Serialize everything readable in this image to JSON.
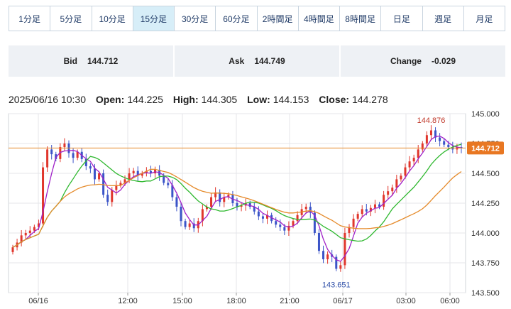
{
  "timeframes": [
    {
      "label": "1分足"
    },
    {
      "label": "5分足"
    },
    {
      "label": "10分足"
    },
    {
      "label": "15分足"
    },
    {
      "label": "30分足"
    },
    {
      "label": "60分足"
    },
    {
      "label": "2時間足"
    },
    {
      "label": "4時間足"
    },
    {
      "label": "8時間足"
    },
    {
      "label": "日足"
    },
    {
      "label": "週足"
    },
    {
      "label": "月足"
    }
  ],
  "quote": {
    "bid_label": "Bid",
    "bid_value": "144.712",
    "ask_label": "Ask",
    "ask_value": "144.749",
    "change_label": "Change",
    "change_value": "-0.029"
  },
  "ohlc": {
    "datetime": "2025/06/16 10:30",
    "open_label": "Open:",
    "open_value": "144.225",
    "high_label": "High:",
    "high_value": "144.305",
    "low_label": "Low:",
    "low_value": "144.153",
    "close_label": "Close:",
    "close_value": "144.278"
  },
  "colors": {
    "up": "#e0362c",
    "down": "#3b54c8",
    "ma_short": "#a020c8",
    "ma_mid": "#2fb82f",
    "ma_long": "#e58a2a",
    "bid_line": "#e58a2a",
    "bid_label_bg": "#e87722",
    "grid": "#e4e6ea"
  },
  "chart_data": {
    "type": "candlestick",
    "ylim": [
      143.5,
      145.0
    ],
    "y_ticks": [
      "145.000",
      "144.750",
      "144.500",
      "144.250",
      "144.000",
      "143.750",
      "143.500"
    ],
    "x_ticks": [
      "06/16",
      "12:00",
      "15:00",
      "18:00",
      "21:00",
      "06/17",
      "03:00",
      "06:00"
    ],
    "current_bid": 144.712,
    "current_bid_label": "144.712",
    "high_annotation": "144.876",
    "low_annotation": "143.651",
    "closes": [
      143.88,
      143.92,
      143.98,
      144.0,
      144.02,
      144.05,
      144.08,
      144.55,
      144.7,
      144.66,
      144.62,
      144.72,
      144.75,
      144.67,
      144.63,
      144.68,
      144.62,
      144.56,
      144.54,
      144.45,
      144.5,
      144.32,
      144.26,
      144.36,
      144.4,
      144.42,
      144.45,
      144.5,
      144.52,
      144.48,
      144.5,
      144.52,
      144.5,
      144.53,
      144.48,
      144.42,
      144.4,
      144.3,
      144.22,
      144.1,
      144.05,
      144.08,
      144.04,
      144.1,
      144.2,
      144.22,
      144.3,
      144.34,
      144.26,
      144.3,
      144.32,
      144.25,
      144.22,
      144.23,
      144.25,
      144.22,
      144.18,
      144.14,
      144.12,
      144.15,
      144.1,
      144.07,
      144.05,
      144.02,
      144.06,
      144.1,
      144.15,
      144.2,
      144.22,
      144.17,
      144.0,
      143.85,
      143.78,
      143.82,
      143.8,
      143.7,
      143.73,
      144.0,
      144.05,
      144.12,
      144.16,
      144.2,
      144.18,
      144.21,
      144.24,
      144.22,
      144.32,
      144.35,
      144.38,
      144.45,
      144.48,
      144.55,
      144.6,
      144.63,
      144.7,
      144.75,
      144.82,
      144.86,
      144.8,
      144.77,
      144.74,
      144.72,
      144.7,
      144.72,
      144.712
    ]
  }
}
